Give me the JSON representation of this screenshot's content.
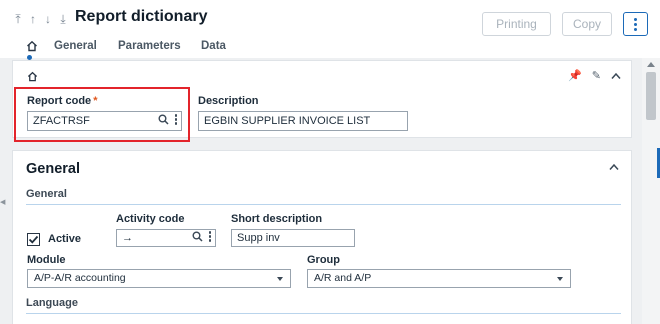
{
  "header": {
    "title": "Report dictionary",
    "nav_icons": [
      "first-record-icon",
      "previous-record-icon",
      "next-record-icon",
      "last-record-icon"
    ],
    "buttons": {
      "printing": "Printing",
      "copy": "Copy"
    }
  },
  "tabs": [
    {
      "icon": "home-icon",
      "active": true
    },
    {
      "label": "General"
    },
    {
      "label": "Parameters"
    },
    {
      "label": "Data"
    }
  ],
  "identity": {
    "report_code_label": "Report code",
    "required_mark": "*",
    "report_code_value": "ZFACTRSF",
    "description_label": "Description",
    "description_value": "EGBIN SUPPLIER INVOICE LIST"
  },
  "general_section": {
    "title": "General",
    "subsection": "General",
    "active_label": "Active",
    "active_checked": true,
    "activity_code_label": "Activity code",
    "activity_code_value": "→",
    "short_description_label": "Short description",
    "short_description_value": "Supp inv",
    "module_label": "Module",
    "module_value": "A/P-A/R accounting",
    "group_label": "Group",
    "group_value": "A/R and A/P",
    "language_label": "Language"
  },
  "colors": {
    "accent": "#1c6ab8",
    "highlight": "#e3242b",
    "required": "#e0561c"
  }
}
